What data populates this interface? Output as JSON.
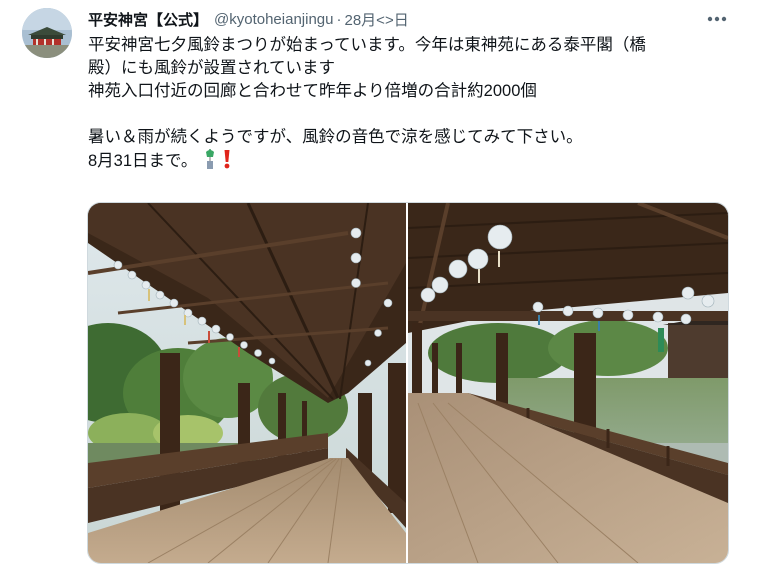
{
  "account": {
    "display_name": "平安神宮【公式】",
    "handle": "@kyotoheianjingu",
    "separator": "·",
    "date": "28月<>日"
  },
  "tweet": {
    "lines": [
      "平安神宮七夕風鈴まつりが始まっています。今年は東神苑にある泰平閣（橋",
      "殿）にも風鈴が設置されています",
      "神苑入口付近の回廊と合わせて昨年より倍増の合計約2000個",
      "暑い＆雨が続くようですが、風鈴の音色で涼を感じてみて下さい。",
      "8月31日まで。"
    ],
    "emojis": [
      "wind-chime-emoji",
      "exclamation-emoji"
    ]
  },
  "media": {
    "photo_count": 2,
    "photos": [
      "corridor-garden-photo",
      "bridge-pond-photo"
    ]
  },
  "colors": {
    "text": "#0f1419",
    "secondary": "#536471",
    "border": "#cfd9de",
    "wood": "#4a3323",
    "floor": "#b89e80"
  }
}
